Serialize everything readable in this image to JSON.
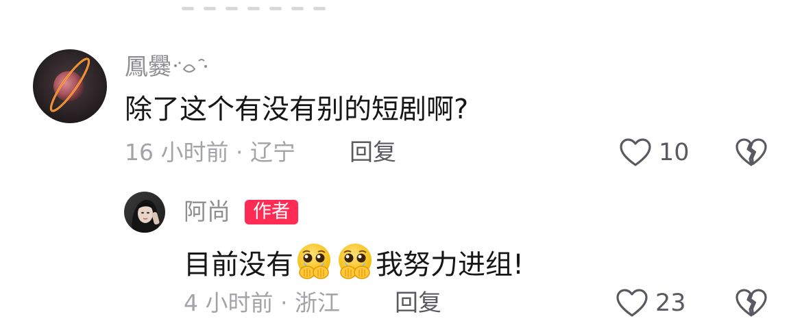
{
  "comments": [
    {
      "username": "鳳爨",
      "text": "除了这个有没有别的短剧啊?",
      "time": "16 小时前",
      "location": "辽宁",
      "meta_separator": " · ",
      "reply_label": "回复",
      "likes": "10"
    }
  ],
  "reply": {
    "username": "阿尚",
    "badge": "作者",
    "text_before": "目前没有",
    "text_after": "我努力进组!",
    "emoji_name": "pleading-face-hands-over-mouth",
    "time": "4 小时前",
    "location": "浙江",
    "meta_separator": " · ",
    "reply_label": "回复",
    "likes": "23"
  },
  "icons": {
    "like": "heart-outline-icon",
    "dislike": "broken-heart-icon"
  },
  "colors": {
    "text": "#161616",
    "muted": "#a3a3a8",
    "username": "#8e8e93",
    "badge": "#fe2c55",
    "action": "#595960"
  }
}
